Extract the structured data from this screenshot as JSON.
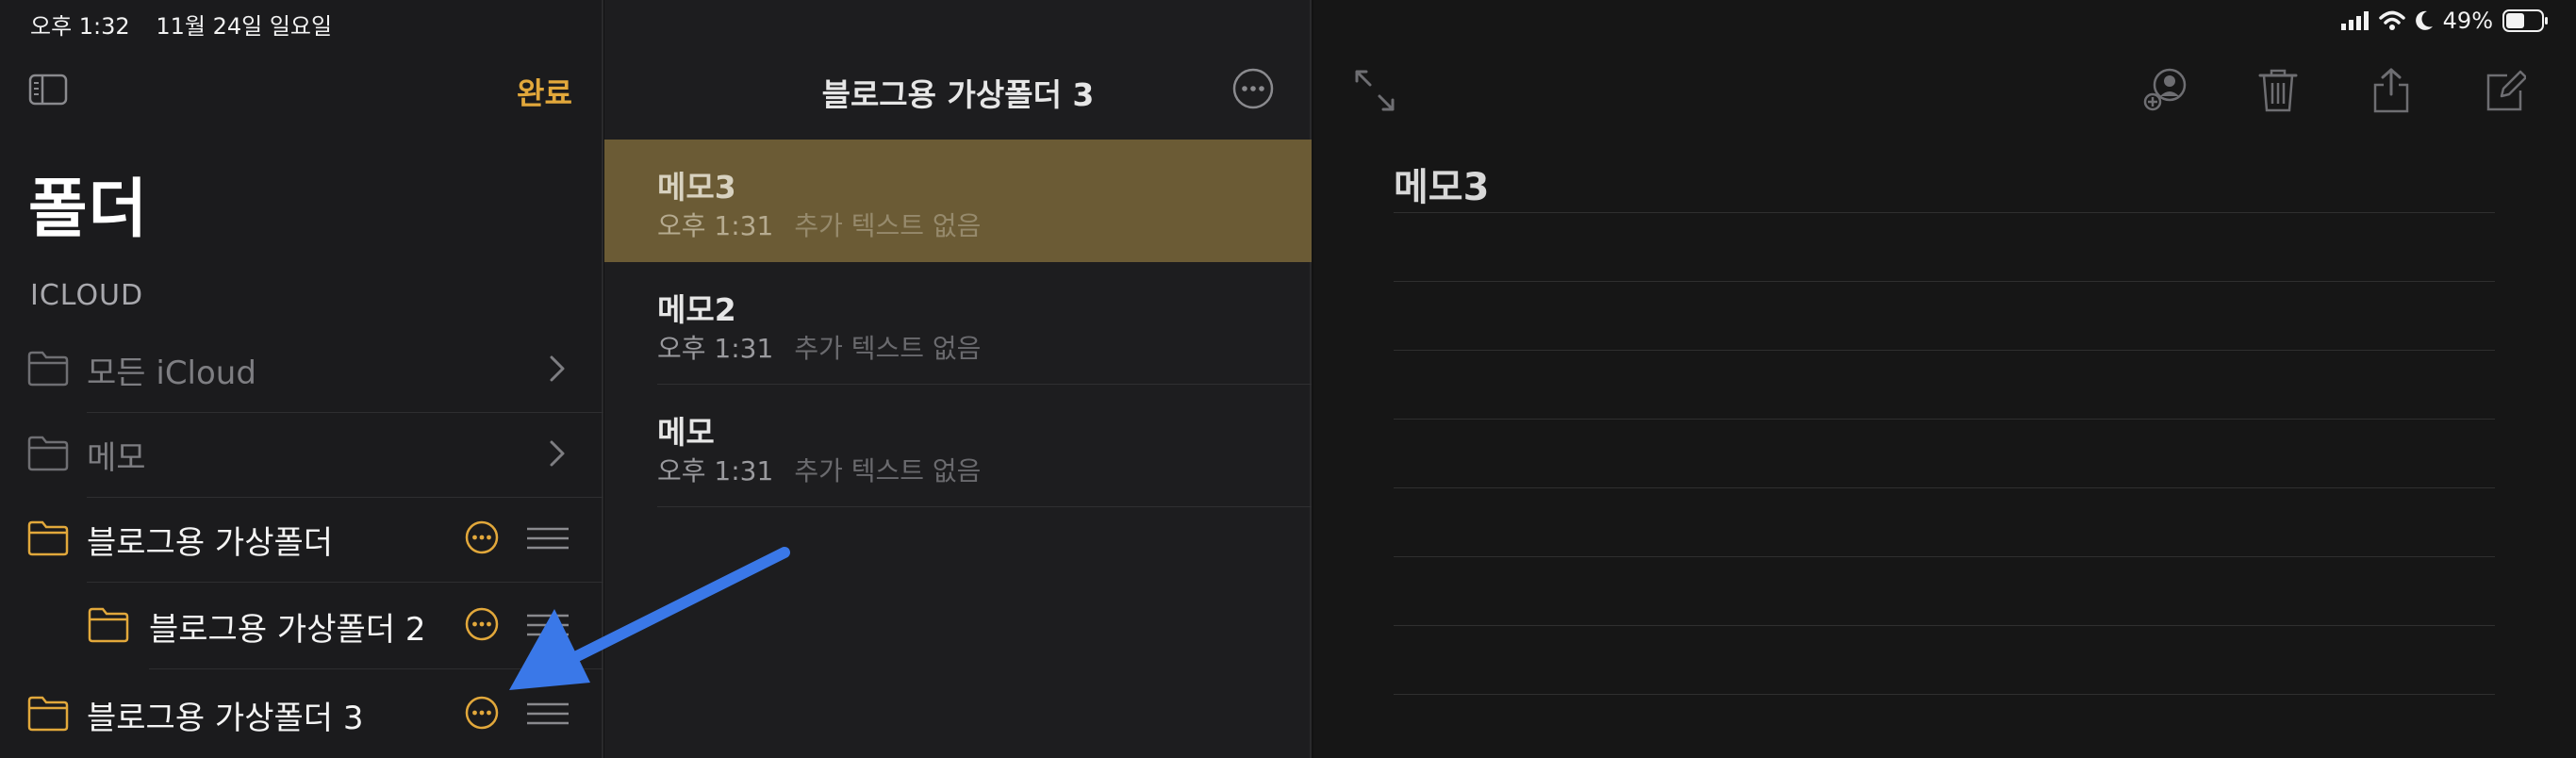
{
  "status": {
    "time": "오후 1:32",
    "date": "11월 24일 일요일",
    "battery": "49%"
  },
  "sidebar": {
    "done_label": "완료",
    "title": "폴더",
    "section": "ICLOUD",
    "folders": [
      {
        "label": "모든 iCloud"
      },
      {
        "label": "메모"
      },
      {
        "label": "블로그용 가상폴더"
      },
      {
        "label": "블로그용 가상폴더 2"
      },
      {
        "label": "블로그용 가상폴더 3"
      }
    ]
  },
  "notes_list": {
    "title": "블로그용 가상폴더 3",
    "notes": [
      {
        "title": "메모3",
        "time": "오후 1:31",
        "preview": "추가 텍스트 없음"
      },
      {
        "title": "메모2",
        "time": "오후 1:31",
        "preview": "추가 텍스트 없음"
      },
      {
        "title": "메모",
        "time": "오후 1:31",
        "preview": "추가 텍스트 없음"
      }
    ]
  },
  "editor": {
    "title": "메모3"
  },
  "colors": {
    "accent": "#e2a83b",
    "selected_row": "#6b5b35",
    "annotation_arrow": "#3a78e8"
  },
  "icons": {
    "sidebar_toggle": "sidebar-icon",
    "folder": "folder-icon",
    "chevron": "chevron-right-icon",
    "more": "ellipsis-circle-icon",
    "drag": "reorder-icon",
    "expand": "expand-icon",
    "share_person": "add-person-icon",
    "trash": "trash-icon",
    "share": "share-icon",
    "compose": "compose-icon"
  }
}
